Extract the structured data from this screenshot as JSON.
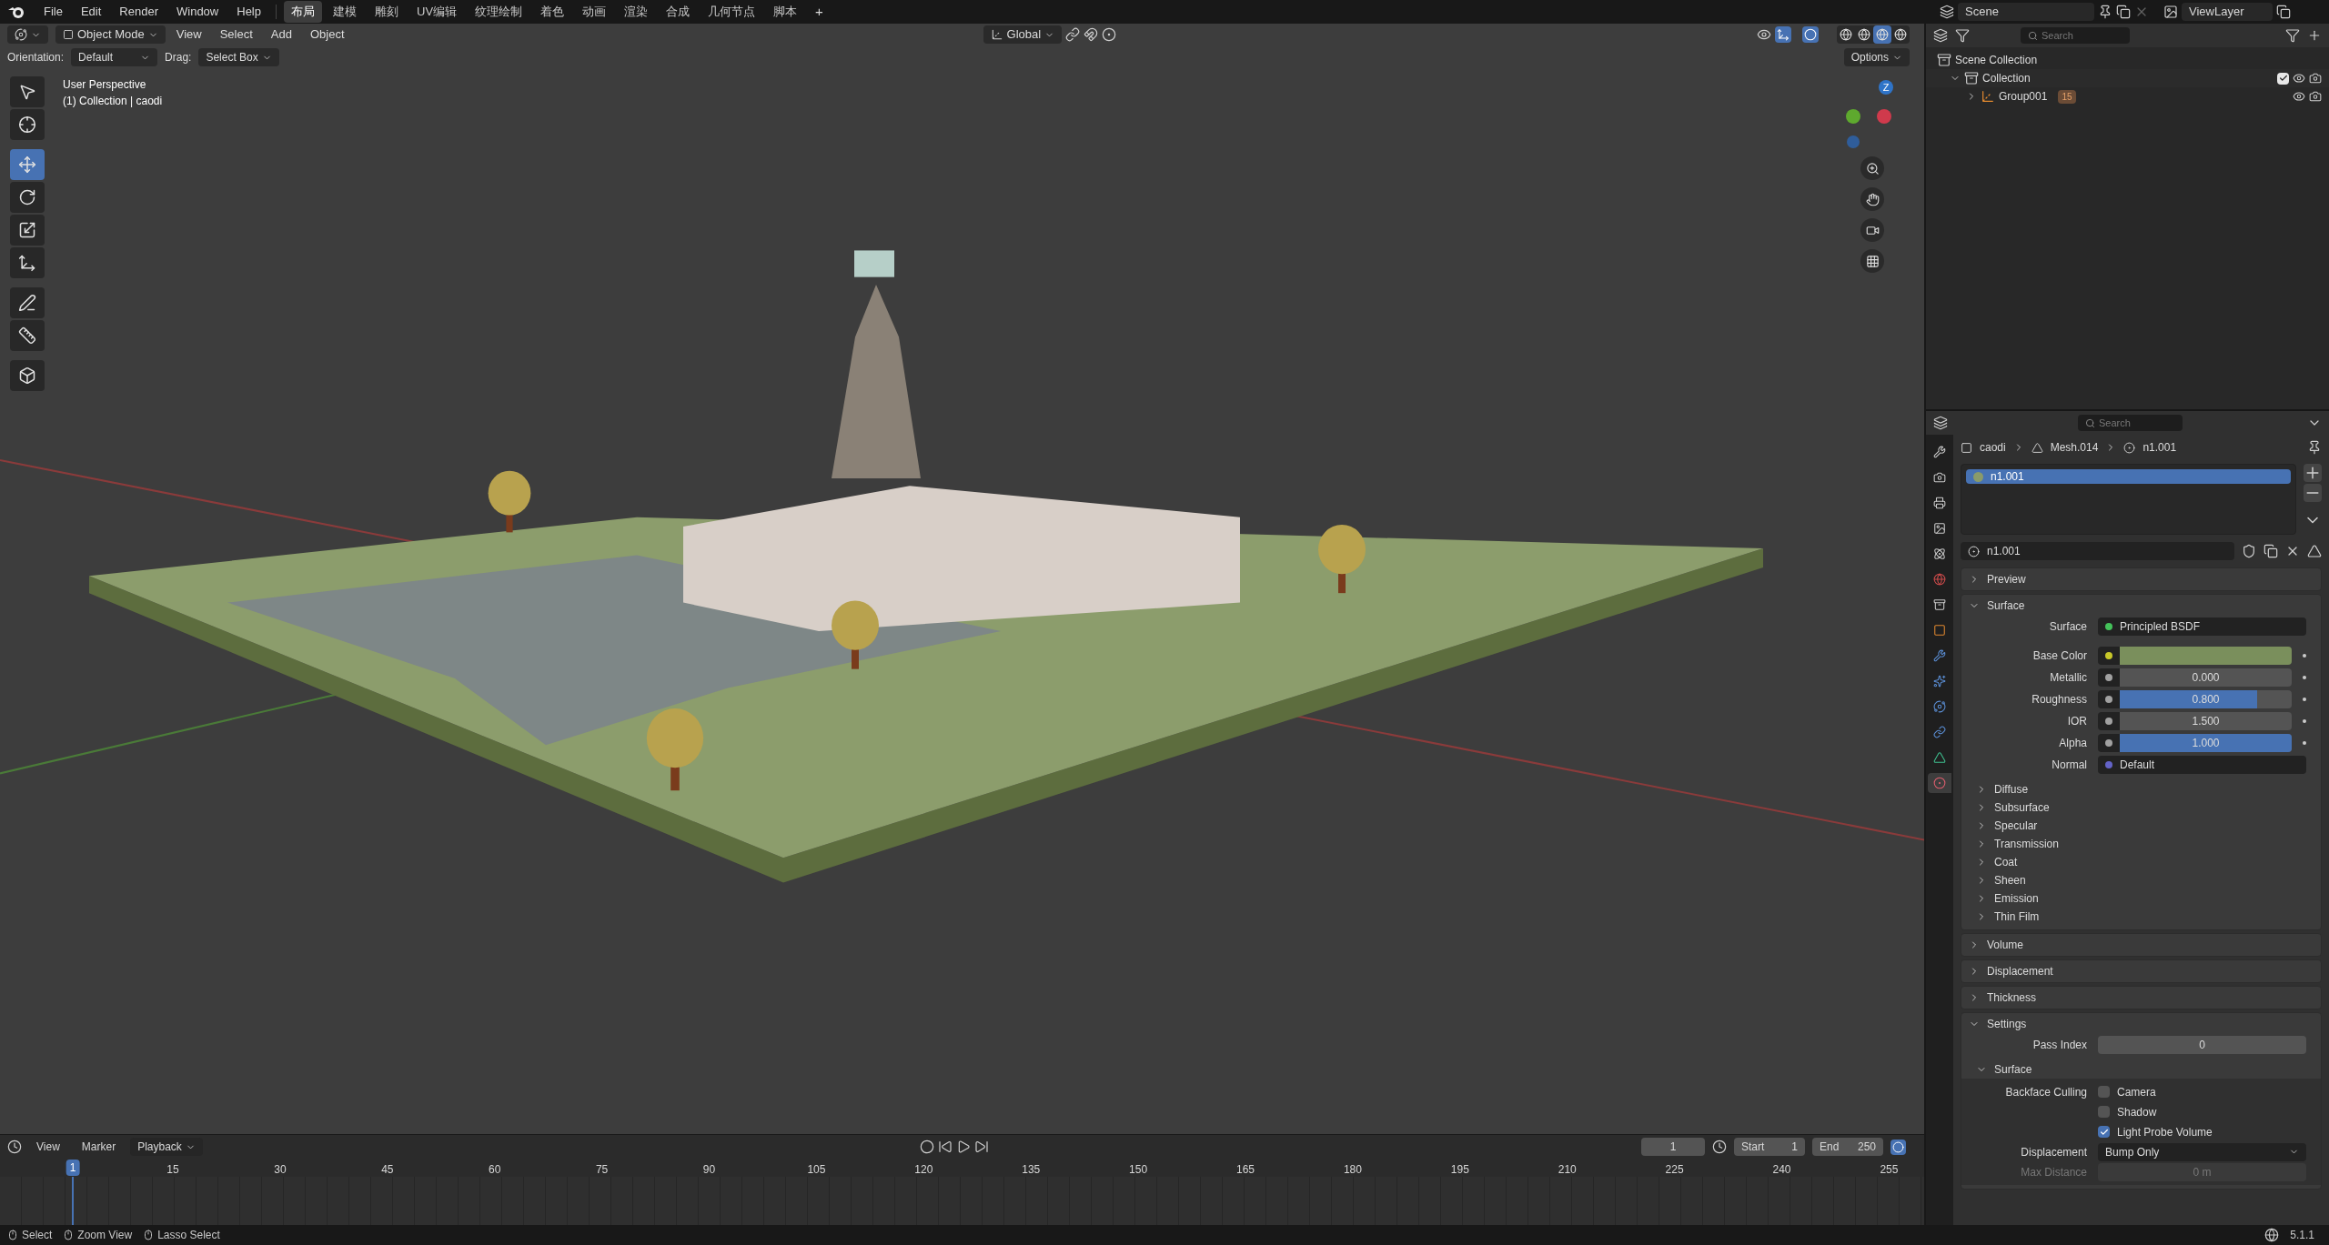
{
  "menubar": {
    "menus": [
      "File",
      "Edit",
      "Render",
      "Window",
      "Help"
    ],
    "workspaces": [
      {
        "label": "布局",
        "selected": true
      },
      {
        "label": "建模",
        "selected": false
      },
      {
        "label": "雕刻",
        "selected": false
      },
      {
        "label": "UV编辑",
        "selected": false
      },
      {
        "label": "纹理绘制",
        "selected": false
      },
      {
        "label": "着色",
        "selected": false
      },
      {
        "label": "动画",
        "selected": false
      },
      {
        "label": "渲染",
        "selected": false
      },
      {
        "label": "合成",
        "selected": false
      },
      {
        "label": "几何节点",
        "selected": false
      },
      {
        "label": "脚本",
        "selected": false
      }
    ],
    "add_tab": "+",
    "scene": "Scene",
    "view_layer": "ViewLayer"
  },
  "viewport": {
    "mode": "Object Mode",
    "menus": [
      "View",
      "Select",
      "Add",
      "Object"
    ],
    "transform": "Global",
    "tool_settings": {
      "orientation_label": "Orientation:",
      "orientation": "Default",
      "drag_label": "Drag:",
      "drag": "Select Box",
      "options": "Options"
    },
    "tools": [
      {
        "kind": "select",
        "selected": false
      },
      {
        "kind": "cursor",
        "selected": false
      },
      {
        "kind": "move",
        "selected": true
      },
      {
        "kind": "rotate",
        "selected": false
      },
      {
        "kind": "scale",
        "selected": false
      },
      {
        "kind": "transform",
        "selected": false
      },
      {
        "kind": "annotate",
        "selected": false
      },
      {
        "kind": "measure",
        "selected": false
      },
      {
        "kind": "add",
        "selected": false
      }
    ],
    "overlay_text": [
      "User Perspective",
      "(1) Collection | caodi"
    ],
    "gizmo_label": "Z",
    "shading": [
      {
        "selected": false
      },
      {
        "selected": false
      },
      {
        "selected": true
      },
      {
        "selected": false
      }
    ]
  },
  "outliner": {
    "search_placeholder": "Search",
    "items": [
      {
        "label": "Scene Collection",
        "kind": "scene",
        "children": [
          {
            "label": "Collection",
            "kind": "collection",
            "expanded": true,
            "checked": true,
            "children": [
              {
                "label": "Group001",
                "kind": "empty",
                "expanded": false,
                "badge": "15"
              }
            ]
          }
        ]
      }
    ]
  },
  "properties": {
    "search_placeholder": "Search",
    "tabs": [
      {
        "kind": "tool",
        "selected": false
      },
      {
        "kind": "render",
        "selected": false
      },
      {
        "kind": "output",
        "selected": false
      },
      {
        "kind": "view_layer",
        "selected": false
      },
      {
        "kind": "scene",
        "selected": false
      },
      {
        "kind": "world",
        "selected": false
      },
      {
        "kind": "collection",
        "selected": false
      },
      {
        "kind": "object",
        "selected": false
      },
      {
        "kind": "modifiers",
        "selected": false
      },
      {
        "kind": "particles",
        "selected": false
      },
      {
        "kind": "physics",
        "selected": false
      },
      {
        "kind": "constraints",
        "selected": false
      },
      {
        "kind": "data",
        "selected": false
      },
      {
        "kind": "material",
        "selected": true
      }
    ],
    "breadcrumb": [
      "caodi",
      "Mesh.014",
      "n1.001"
    ],
    "slots": [
      {
        "label": "n1.001",
        "selected": true
      }
    ],
    "material_name": "n1.001",
    "panels": [
      {
        "title": "Preview",
        "expanded": false
      },
      {
        "title": "Surface",
        "expanded": true,
        "fields": [
          {
            "kind": "link",
            "label": "Surface",
            "value": "Principled BSDF",
            "color": "#44c25a"
          },
          {
            "kind": "swatch",
            "label": "Base Color",
            "swatch": {
              "color": "#7a8f5c"
            },
            "color": "#c7c729"
          },
          {
            "kind": "slider",
            "label": "Metallic",
            "value": "0.000",
            "level": 0,
            "color": "#a1a1a1"
          },
          {
            "kind": "slider",
            "label": "Roughness",
            "value": "0.800",
            "level": 0.8,
            "color": "#a1a1a1"
          },
          {
            "kind": "number",
            "label": "IOR",
            "value": "1.500",
            "color": "#a1a1a1"
          },
          {
            "kind": "slider",
            "label": "Alpha",
            "value": "1.000",
            "level": 1,
            "color": "#a1a1a1"
          },
          {
            "kind": "link",
            "label": "Normal",
            "value": "Default",
            "color": "#6363c7"
          }
        ],
        "subpanels": [
          {
            "title": "Diffuse",
            "expanded": false
          },
          {
            "title": "Subsurface",
            "expanded": false
          },
          {
            "title": "Specular",
            "expanded": false
          },
          {
            "title": "Transmission",
            "expanded": false
          },
          {
            "title": "Coat",
            "expanded": false
          },
          {
            "title": "Sheen",
            "expanded": false
          },
          {
            "title": "Emission",
            "expanded": false
          },
          {
            "title": "Thin Film",
            "expanded": false
          }
        ]
      },
      {
        "title": "Volume",
        "expanded": false
      },
      {
        "title": "Displacement",
        "expanded": false
      },
      {
        "title": "Thickness",
        "expanded": false
      },
      {
        "title": "Settings",
        "expanded": true,
        "fields": [
          {
            "kind": "number",
            "label": "Pass Index",
            "value": "0"
          }
        ],
        "subpanels": [
          {
            "title": "Surface",
            "expanded": true,
            "fields": [
              {
                "kind": "checkbox",
                "label": "Backface Culling",
                "text": "Camera",
                "checked": false
              },
              {
                "kind": "checkbox",
                "text": "Shadow",
                "checked": false
              },
              {
                "kind": "checkbox",
                "text": "Light Probe Volume",
                "checked": true
              },
              {
                "kind": "dropdown",
                "label": "Displacement",
                "value": "Bump Only"
              },
              {
                "kind": "number",
                "label": "Max Distance",
                "value": "0 m",
                "disabled": true
              }
            ]
          }
        ]
      }
    ]
  },
  "timeline": {
    "menus": [
      {
        "label": "View",
        "kind": "menu"
      },
      {
        "label": "Marker",
        "kind": "menu"
      },
      {
        "label": "Playback",
        "kind": "dropdown"
      }
    ],
    "current_frame": "1",
    "start_label": "Start",
    "start": "1",
    "end_label": "End",
    "end": "250",
    "ruler": [
      "15",
      "30",
      "45",
      "60",
      "75",
      "90",
      "105",
      "120",
      "135",
      "150",
      "165",
      "180",
      "195",
      "210",
      "225",
      "240",
      "255"
    ],
    "playhead": "1"
  },
  "status_bar": {
    "hints": [
      "Select",
      "Zoom View",
      "Lasso Select"
    ],
    "version": "5.1.1"
  }
}
